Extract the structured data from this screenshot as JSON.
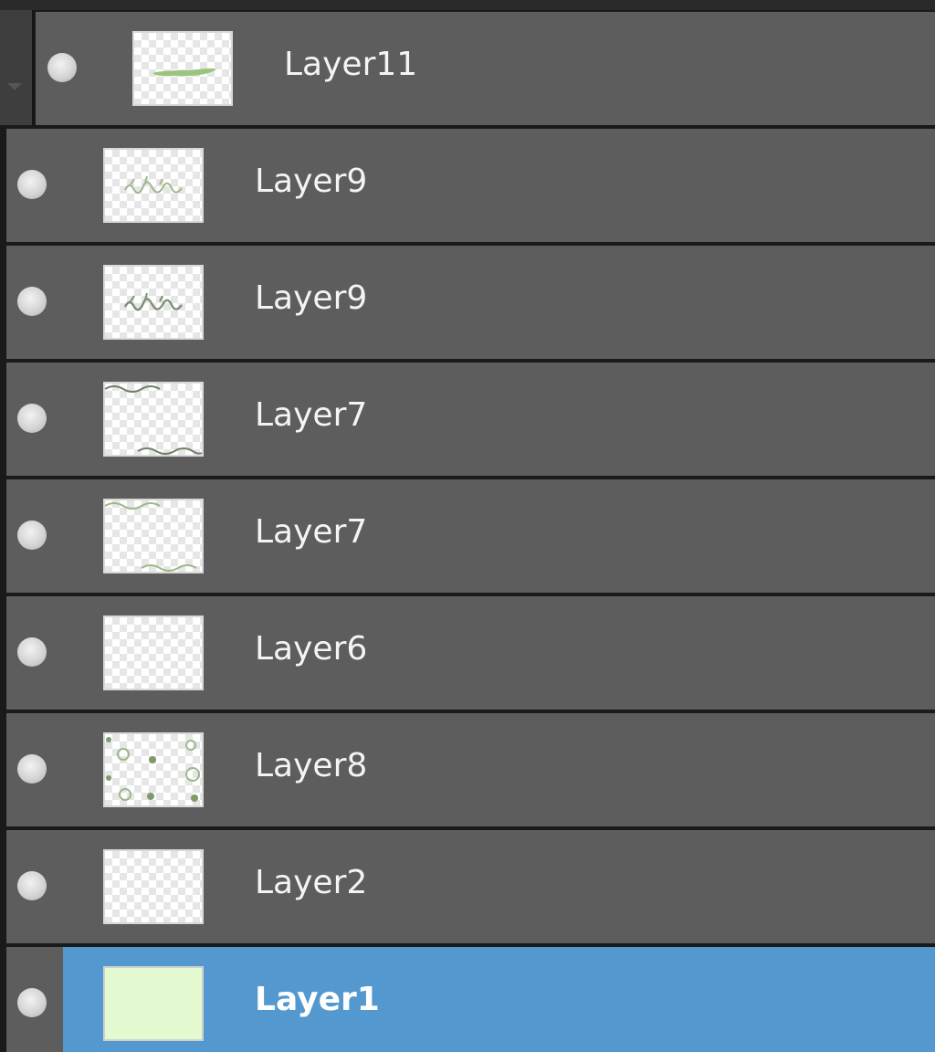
{
  "panel": {
    "title": ""
  },
  "layers": [
    {
      "name": "Layer11",
      "thumbnail": "green-stroke",
      "visible": true,
      "selected": false,
      "in_group": true
    },
    {
      "name": "Layer9",
      "thumbnail": "squiggle-sketch",
      "visible": true,
      "selected": false,
      "in_group": false
    },
    {
      "name": "Layer9",
      "thumbnail": "squiggle-sketch-dark",
      "visible": true,
      "selected": false,
      "in_group": false
    },
    {
      "name": "Layer7",
      "thumbnail": "wave-border-dark",
      "visible": true,
      "selected": false,
      "in_group": false
    },
    {
      "name": "Layer7",
      "thumbnail": "wave-border-green",
      "visible": true,
      "selected": false,
      "in_group": false
    },
    {
      "name": "Layer6",
      "thumbnail": "faint-line",
      "visible": true,
      "selected": false,
      "in_group": false
    },
    {
      "name": "Layer8",
      "thumbnail": "dots-pattern",
      "visible": true,
      "selected": false,
      "in_group": false
    },
    {
      "name": "Layer2",
      "thumbnail": "empty",
      "visible": true,
      "selected": false,
      "in_group": false
    },
    {
      "name": "Layer1",
      "thumbnail": "solid-fill",
      "visible": true,
      "selected": true,
      "in_group": false
    }
  ],
  "colors": {
    "row_background": "#5d5d5d",
    "selected_background": "#5399d0",
    "row_separator": "#1a1a1a",
    "layer1_fill": "#e3fad0",
    "sketch_green": "#8fb872"
  },
  "icons": {
    "visibility": "eye-dot-icon",
    "group_collapse": "chevron-down-icon"
  }
}
